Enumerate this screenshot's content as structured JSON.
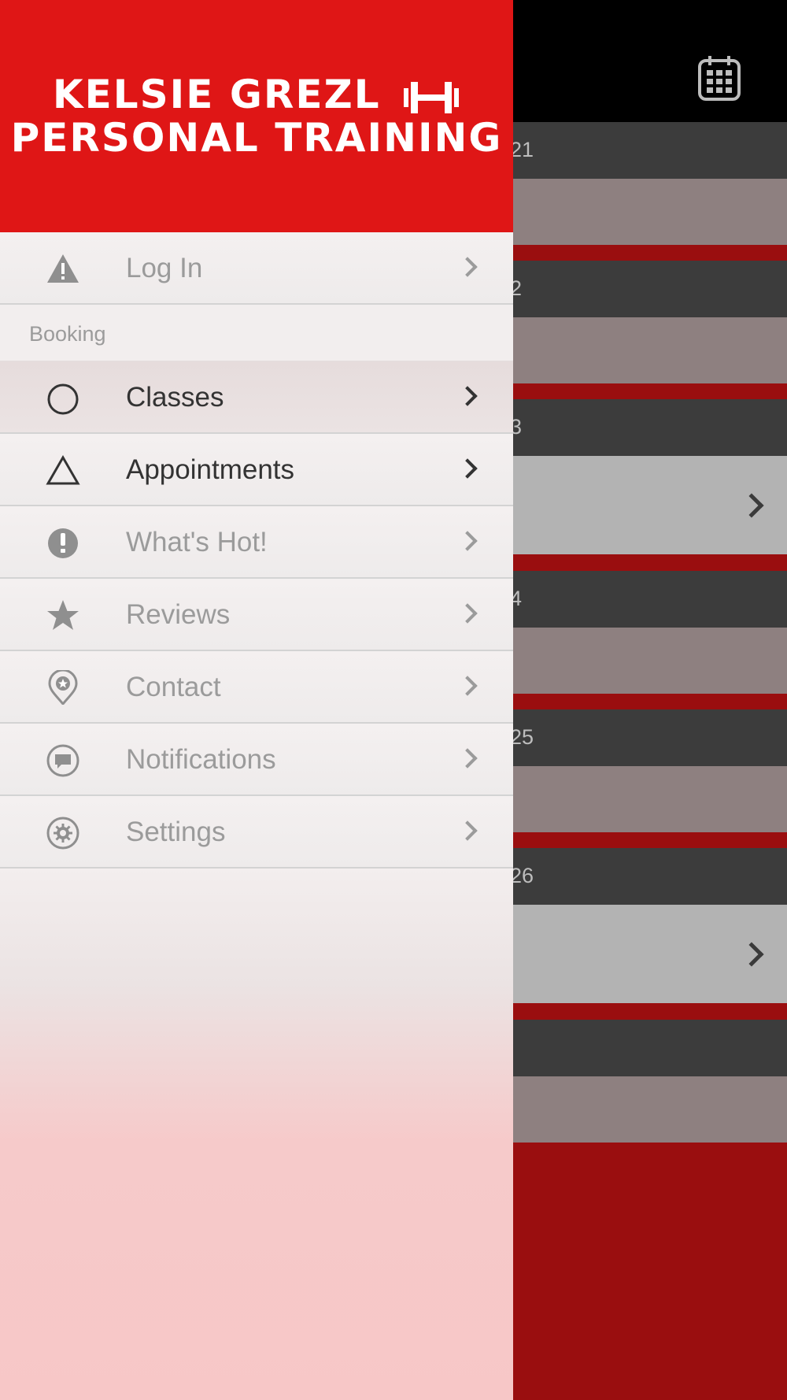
{
  "drawer": {
    "logo": {
      "line1": "KELSIE GREZL",
      "line2": "PERSONAL TRAINING"
    },
    "login": {
      "label": "Log In",
      "icon": "warning-icon"
    },
    "section_booking": "Booking",
    "items": [
      {
        "label": "Classes",
        "icon": "circle-icon",
        "active": true
      },
      {
        "label": "Appointments",
        "icon": "triangle-icon"
      },
      {
        "label": "What's Hot!",
        "icon": "exclamation-icon"
      },
      {
        "label": "Reviews",
        "icon": "star-icon"
      },
      {
        "label": "Contact",
        "icon": "location-pin-icon"
      },
      {
        "label": "Notifications",
        "icon": "chat-bubble-icon"
      },
      {
        "label": "Settings",
        "icon": "gear-icon"
      }
    ]
  },
  "background": {
    "day_headers": [
      "21",
      "2",
      "3",
      "4",
      "25",
      "26",
      ""
    ],
    "calendar_icon": "calendar-icon"
  },
  "colors": {
    "brand_red": "#df1616",
    "dark_red": "#9a0e0f",
    "header_black": "#000000"
  }
}
